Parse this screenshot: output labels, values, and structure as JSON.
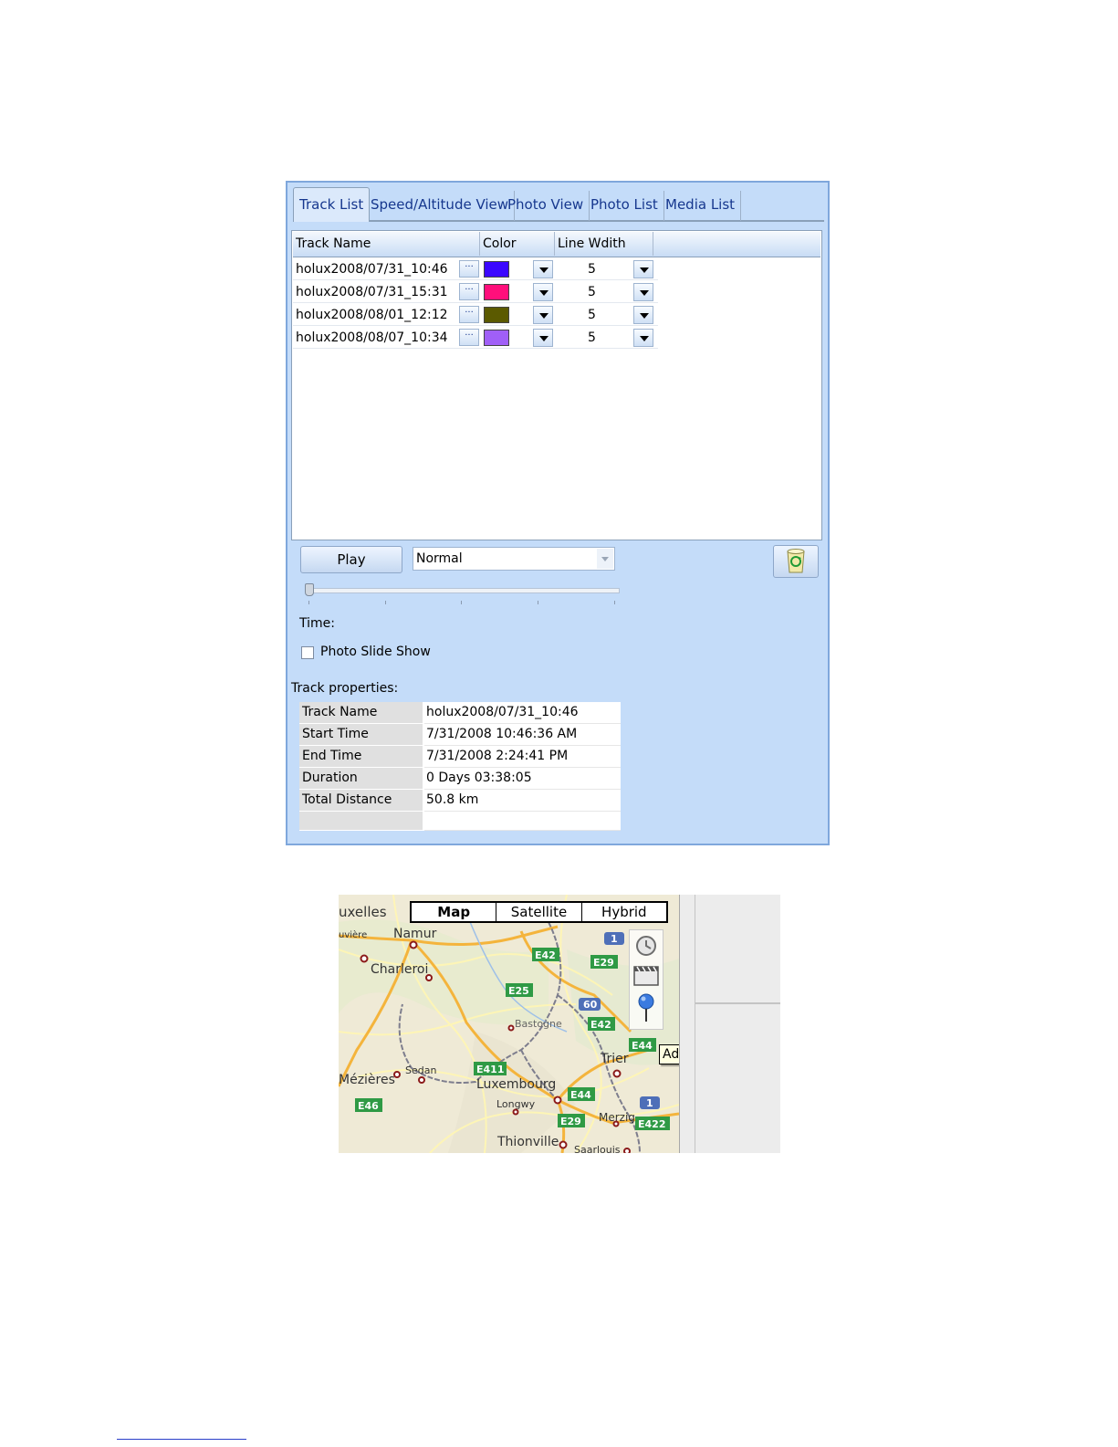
{
  "tabs": [
    {
      "label": "Track List",
      "active": true
    },
    {
      "label": "Speed/Altitude View",
      "active": false
    },
    {
      "label": "Photo View",
      "active": false
    },
    {
      "label": "Photo List",
      "active": false
    },
    {
      "label": "Media List",
      "active": false
    }
  ],
  "track_list": {
    "columns": [
      "Track Name",
      "Color",
      "Line Wdith"
    ],
    "rows": [
      {
        "name": "holux2008/07/31_10:46",
        "color": "#3b07ff",
        "line_width": "5"
      },
      {
        "name": "holux2008/07/31_15:31",
        "color": "#ff0f7b",
        "line_width": "5"
      },
      {
        "name": "holux2008/08/01_12:12",
        "color": "#5b5a00",
        "line_width": "5"
      },
      {
        "name": "holux2008/08/07_10:34",
        "color": "#a05ff7",
        "line_width": "5"
      }
    ]
  },
  "playback": {
    "play_label": "Play",
    "speed_value": "Normal",
    "time_label": "Time:",
    "slider_position": 0,
    "photo_slideshow_label": "Photo Slide Show",
    "photo_slideshow_checked": false
  },
  "properties": {
    "title": "Track properties:",
    "rows": [
      {
        "key": "Track Name",
        "value": "holux2008/07/31_10:46"
      },
      {
        "key": "Start Time",
        "value": "7/31/2008 10:46:36 AM"
      },
      {
        "key": "End Time",
        "value": "7/31/2008 2:24:41 PM"
      },
      {
        "key": "Duration",
        "value": "0 Days  03:38:05"
      },
      {
        "key": "Total Distance",
        "value": "50.8 km"
      },
      {
        "key": "",
        "value": ""
      }
    ]
  },
  "map": {
    "map_types": [
      {
        "label": "Map",
        "selected": true
      },
      {
        "label": "Satellite",
        "selected": false
      },
      {
        "label": "Hybrid",
        "selected": false
      }
    ],
    "tools": [
      "history-icon",
      "film-icon",
      "placemark-pin-icon"
    ],
    "tooltip": "Add Placemark",
    "place_labels": [
      "uxelles",
      "uvière",
      "Namur",
      "Charleroi",
      "Bastogne",
      "Trier",
      "Mézières",
      "Sedan",
      "Luxembourg",
      "Longwy",
      "Merzig",
      "Thionville",
      "Saarlouis"
    ],
    "road_labels": [
      "E42",
      "E29",
      "E25",
      "E42",
      "E44",
      "E411",
      "E44",
      "E46",
      "E29",
      "E422",
      "60",
      "1",
      "1"
    ]
  },
  "colors": {
    "panel_bg": "#c4dcf9",
    "tab_text": "#16378e"
  }
}
